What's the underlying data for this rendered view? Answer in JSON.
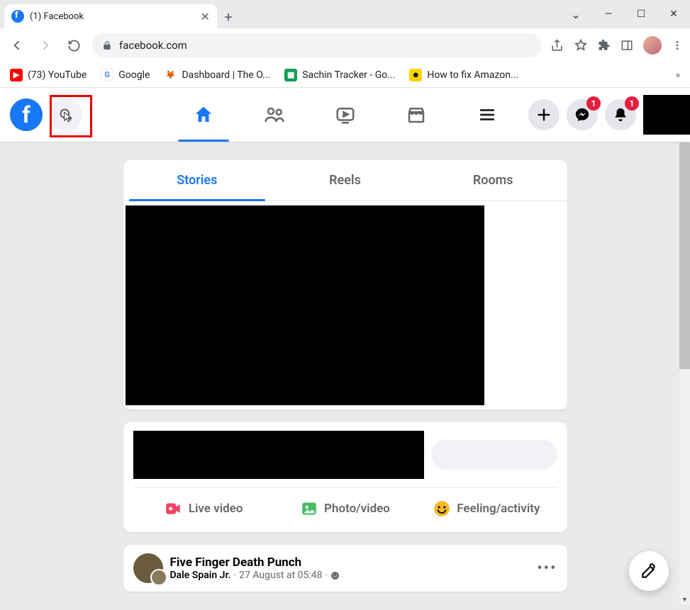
{
  "browser": {
    "tab_title": "(1) Facebook",
    "url": "facebook.com",
    "bookmarks": [
      {
        "label": "(73) YouTube",
        "icon_bg": "#ff0000",
        "icon_txt": "▶"
      },
      {
        "label": "Google",
        "icon_bg": "#ffffff",
        "icon_txt": "G"
      },
      {
        "label": "Dashboard | The O...",
        "icon_bg": "#ffffff",
        "icon_txt": "🦊"
      },
      {
        "label": "Sachin Tracker - Go...",
        "icon_bg": "#0f9d58",
        "icon_txt": "▦"
      },
      {
        "label": "How to fix Amazon...",
        "icon_bg": "#ffd400",
        "icon_txt": "☻"
      }
    ]
  },
  "fb_header": {
    "messenger_badge": "1",
    "notifications_badge": "1"
  },
  "feed_tabs": {
    "stories": "Stories",
    "reels": "Reels",
    "rooms": "Rooms"
  },
  "composer": {
    "live": "Live video",
    "photo": "Photo/video",
    "feeling": "Feeling/activity"
  },
  "post": {
    "title": "Five Finger Death Punch",
    "author": "Dale Spain Jr.",
    "sep": " · ",
    "time": "27 August at 05:48",
    "sep2": " · "
  }
}
